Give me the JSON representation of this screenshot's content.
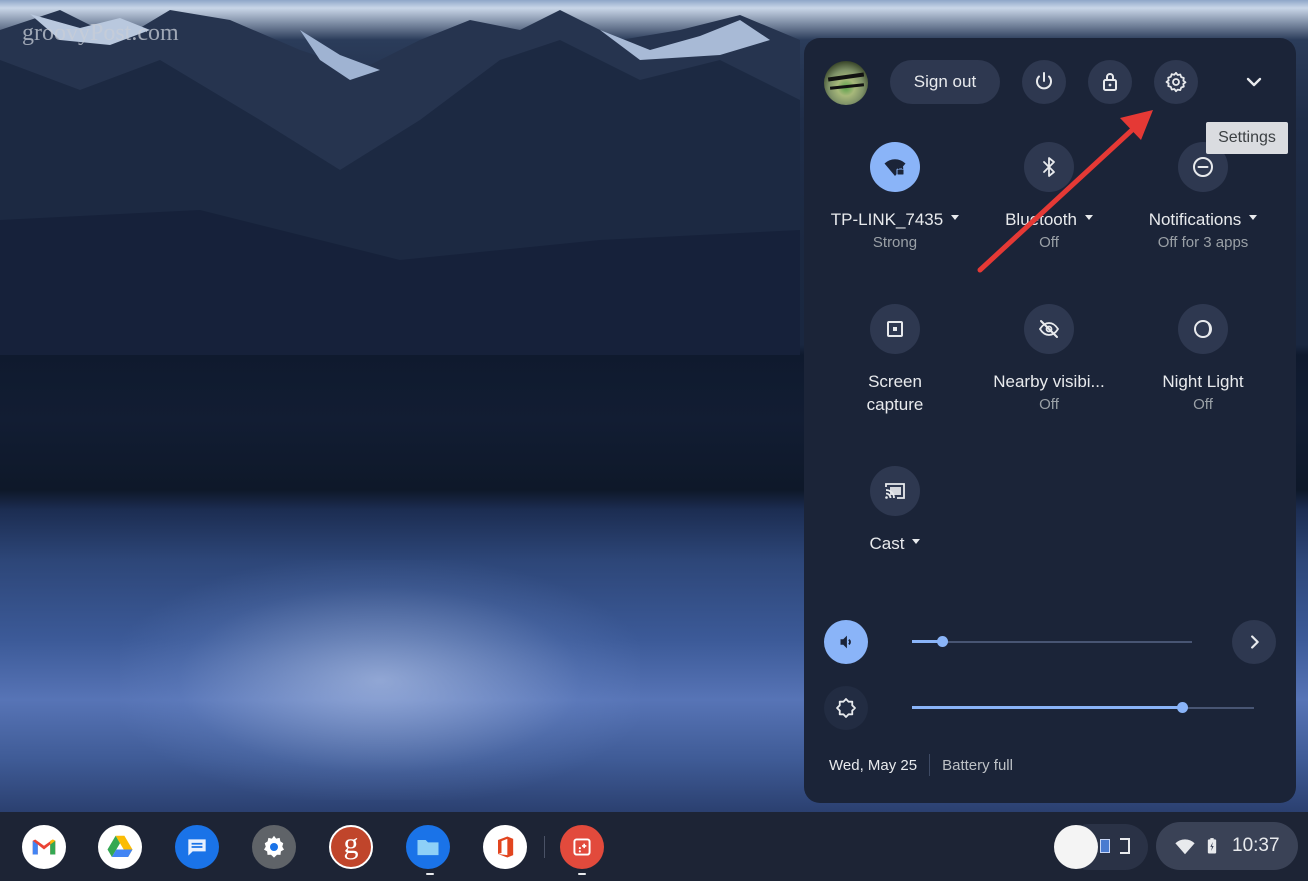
{
  "watermark": "groovyPost.com",
  "quick_settings": {
    "sign_out_label": "Sign out",
    "top_buttons": [
      {
        "name": "power",
        "icon": "power-icon"
      },
      {
        "name": "lock",
        "icon": "lock-icon"
      },
      {
        "name": "settings",
        "icon": "gear-icon"
      },
      {
        "name": "collapse",
        "icon": "chevron-down-icon"
      }
    ],
    "tooltip": "Settings",
    "tiles": [
      {
        "label": "TP-LINK_7435",
        "sub": "Strong",
        "dropdown": true,
        "active": true,
        "icon": "wifi-lock-icon"
      },
      {
        "label": "Bluetooth",
        "sub": "Off",
        "dropdown": true,
        "active": false,
        "icon": "bluetooth-icon"
      },
      {
        "label": "Notifications",
        "sub": "Off for 3 apps",
        "dropdown": true,
        "active": false,
        "icon": "do-not-disturb-icon"
      },
      {
        "label": "Screen",
        "label2": "capture",
        "active": false,
        "icon": "screen-capture-icon"
      },
      {
        "label": "Nearby visibi...",
        "sub": "Off",
        "active": false,
        "icon": "visibility-off-icon"
      },
      {
        "label": "Night Light",
        "sub": "Off",
        "active": false,
        "icon": "night-light-icon"
      },
      {
        "label": "Cast",
        "dropdown": true,
        "active": false,
        "icon": "cast-icon"
      }
    ],
    "volume": {
      "level": 0.11,
      "icon": "volume-icon"
    },
    "brightness": {
      "level": 0.79,
      "icon": "brightness-icon"
    },
    "date": "Wed, May 25",
    "battery": "Battery full"
  },
  "shelf": {
    "apps": [
      {
        "name": "Gmail",
        "icon": "gmail-icon"
      },
      {
        "name": "Google Drive",
        "icon": "drive-icon"
      },
      {
        "name": "Messages",
        "icon": "messages-icon"
      },
      {
        "name": "Settings",
        "icon": "settings-app-icon"
      },
      {
        "name": "groovyPost",
        "icon": "groovypost-icon"
      },
      {
        "name": "Files",
        "icon": "files-icon",
        "running": true
      },
      {
        "name": "Office",
        "icon": "office-icon"
      },
      {
        "name": "App",
        "icon": "red-app-icon",
        "running": true
      }
    ],
    "time": "10:37"
  },
  "colors": {
    "accent": "#8ab4f8",
    "panel": "#1b2438",
    "annotation_arrow": "#e53935"
  }
}
